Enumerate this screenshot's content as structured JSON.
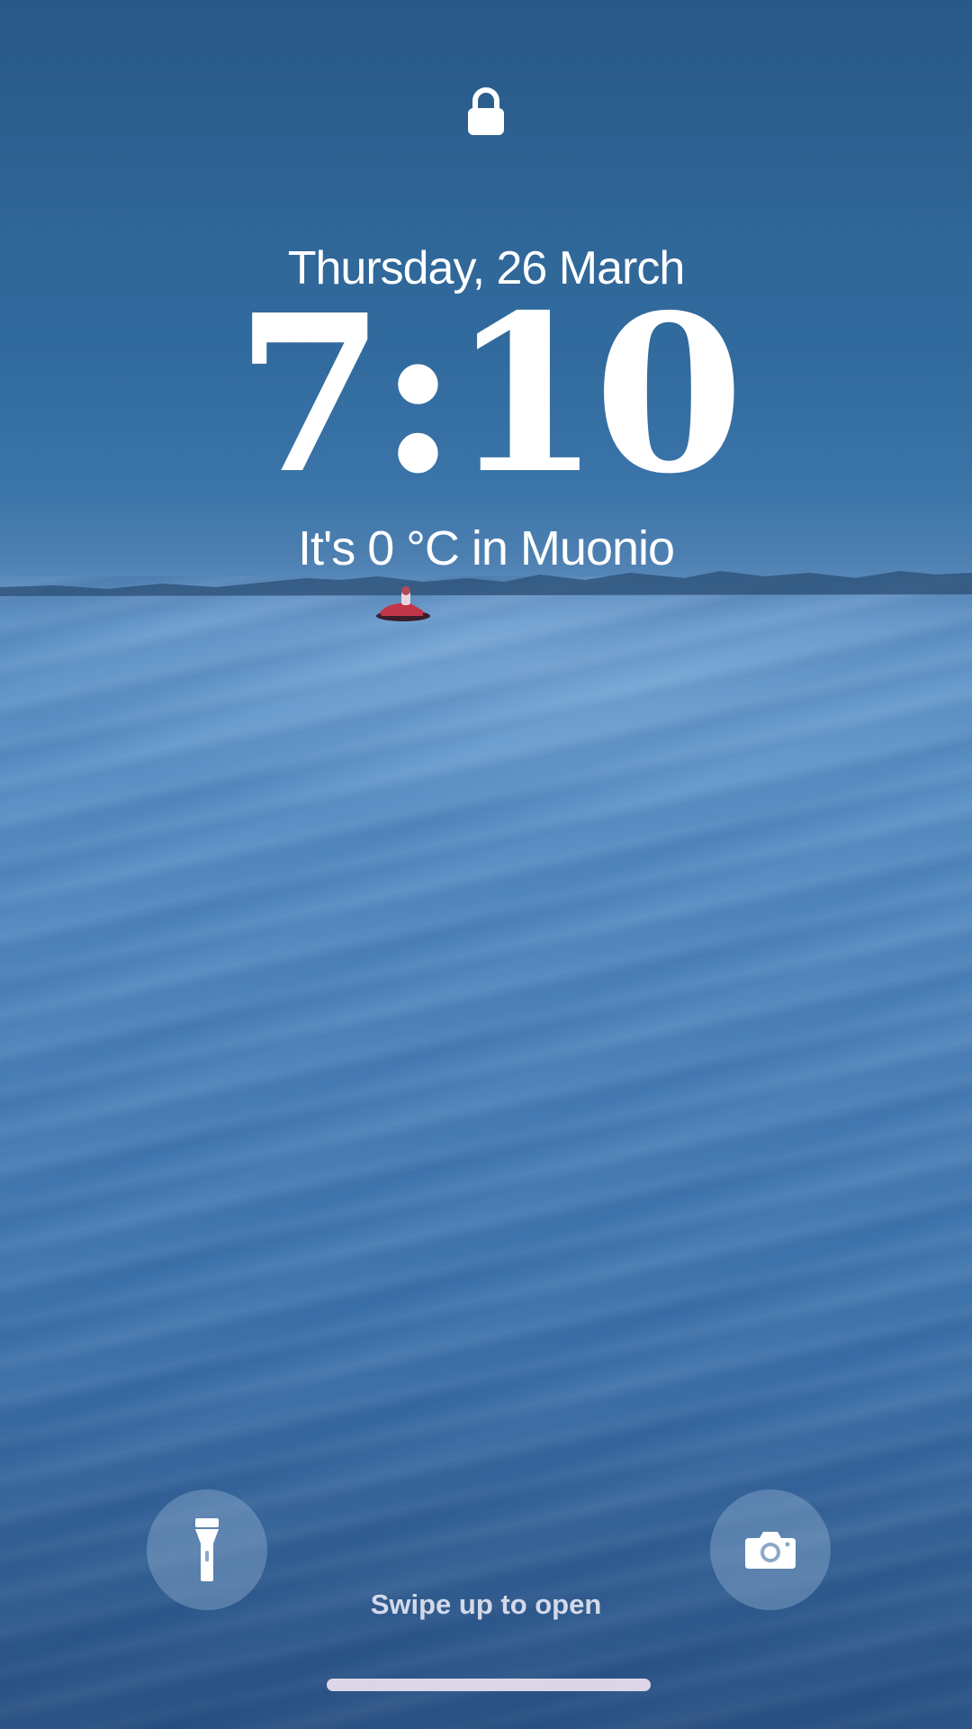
{
  "lock_screen": {
    "date": "Thursday, 26 March",
    "time": "7:10",
    "weather": "It's 0 °C in Muonio",
    "swipe_hint": "Swipe up to open"
  },
  "icons": {
    "lock": "lock-icon",
    "flashlight": "flashlight-icon",
    "camera": "camera-icon"
  },
  "colors": {
    "text": "#ffffff",
    "sky": "#2f6595",
    "snow": "#5f94c8"
  }
}
